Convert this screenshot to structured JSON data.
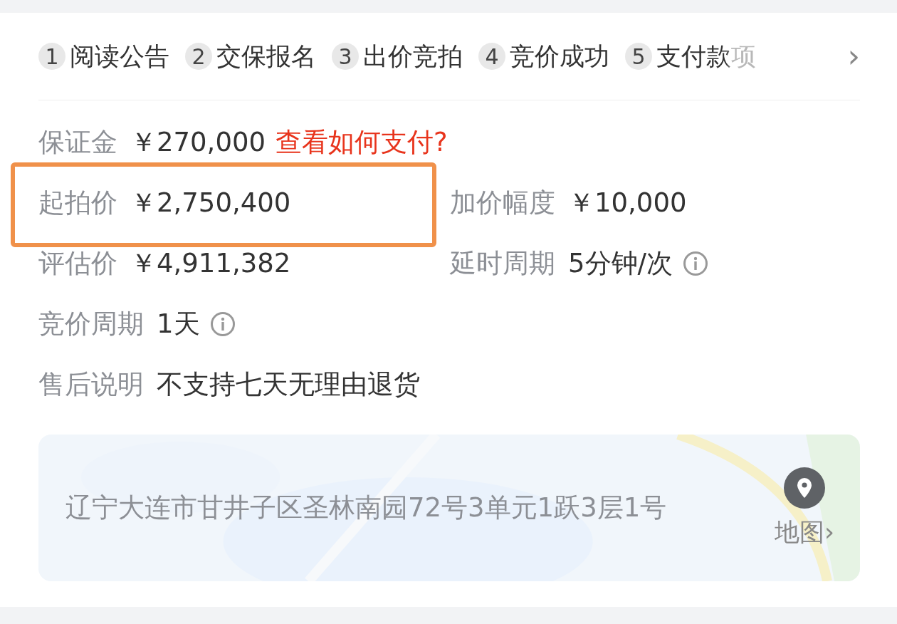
{
  "steps": [
    {
      "number": "1",
      "label": "阅读公告",
      "faded": false
    },
    {
      "number": "2",
      "label": "交保报名",
      "faded": false
    },
    {
      "number": "3",
      "label": "出价竞拍",
      "faded": false
    },
    {
      "number": "4",
      "label": "竞价成功",
      "faded": false
    },
    {
      "number": "5",
      "label": "支付款项",
      "faded": true
    }
  ],
  "steps_more": "›",
  "rows": [
    {
      "cells": [
        {
          "label": "保证金",
          "value": "￥270,000",
          "link": "查看如何支付?",
          "info": false,
          "highlighted": false
        }
      ]
    },
    {
      "cells": [
        {
          "label": "起拍价",
          "value": "￥2,750,400",
          "info": false,
          "highlighted": true
        },
        {
          "label": "加价幅度",
          "value": "￥10,000",
          "info": false,
          "highlighted": false
        }
      ]
    },
    {
      "cells": [
        {
          "label": "评估价",
          "value": "￥4,911,382",
          "info": false,
          "highlighted": false
        },
        {
          "label": "延时周期",
          "value": "5分钟/次",
          "info": true,
          "highlighted": false
        }
      ]
    },
    {
      "cells": [
        {
          "label": "竞价周期",
          "value": "1天",
          "info": true,
          "highlighted": false
        }
      ]
    },
    {
      "cells": [
        {
          "label": "售后说明",
          "value": "不支持七天无理由退货",
          "info": false,
          "highlighted": false
        }
      ]
    }
  ],
  "location": {
    "address": "辽宁大连市甘井子区圣林南园72号3单元1跃3层1号",
    "map_link": "地图›"
  }
}
